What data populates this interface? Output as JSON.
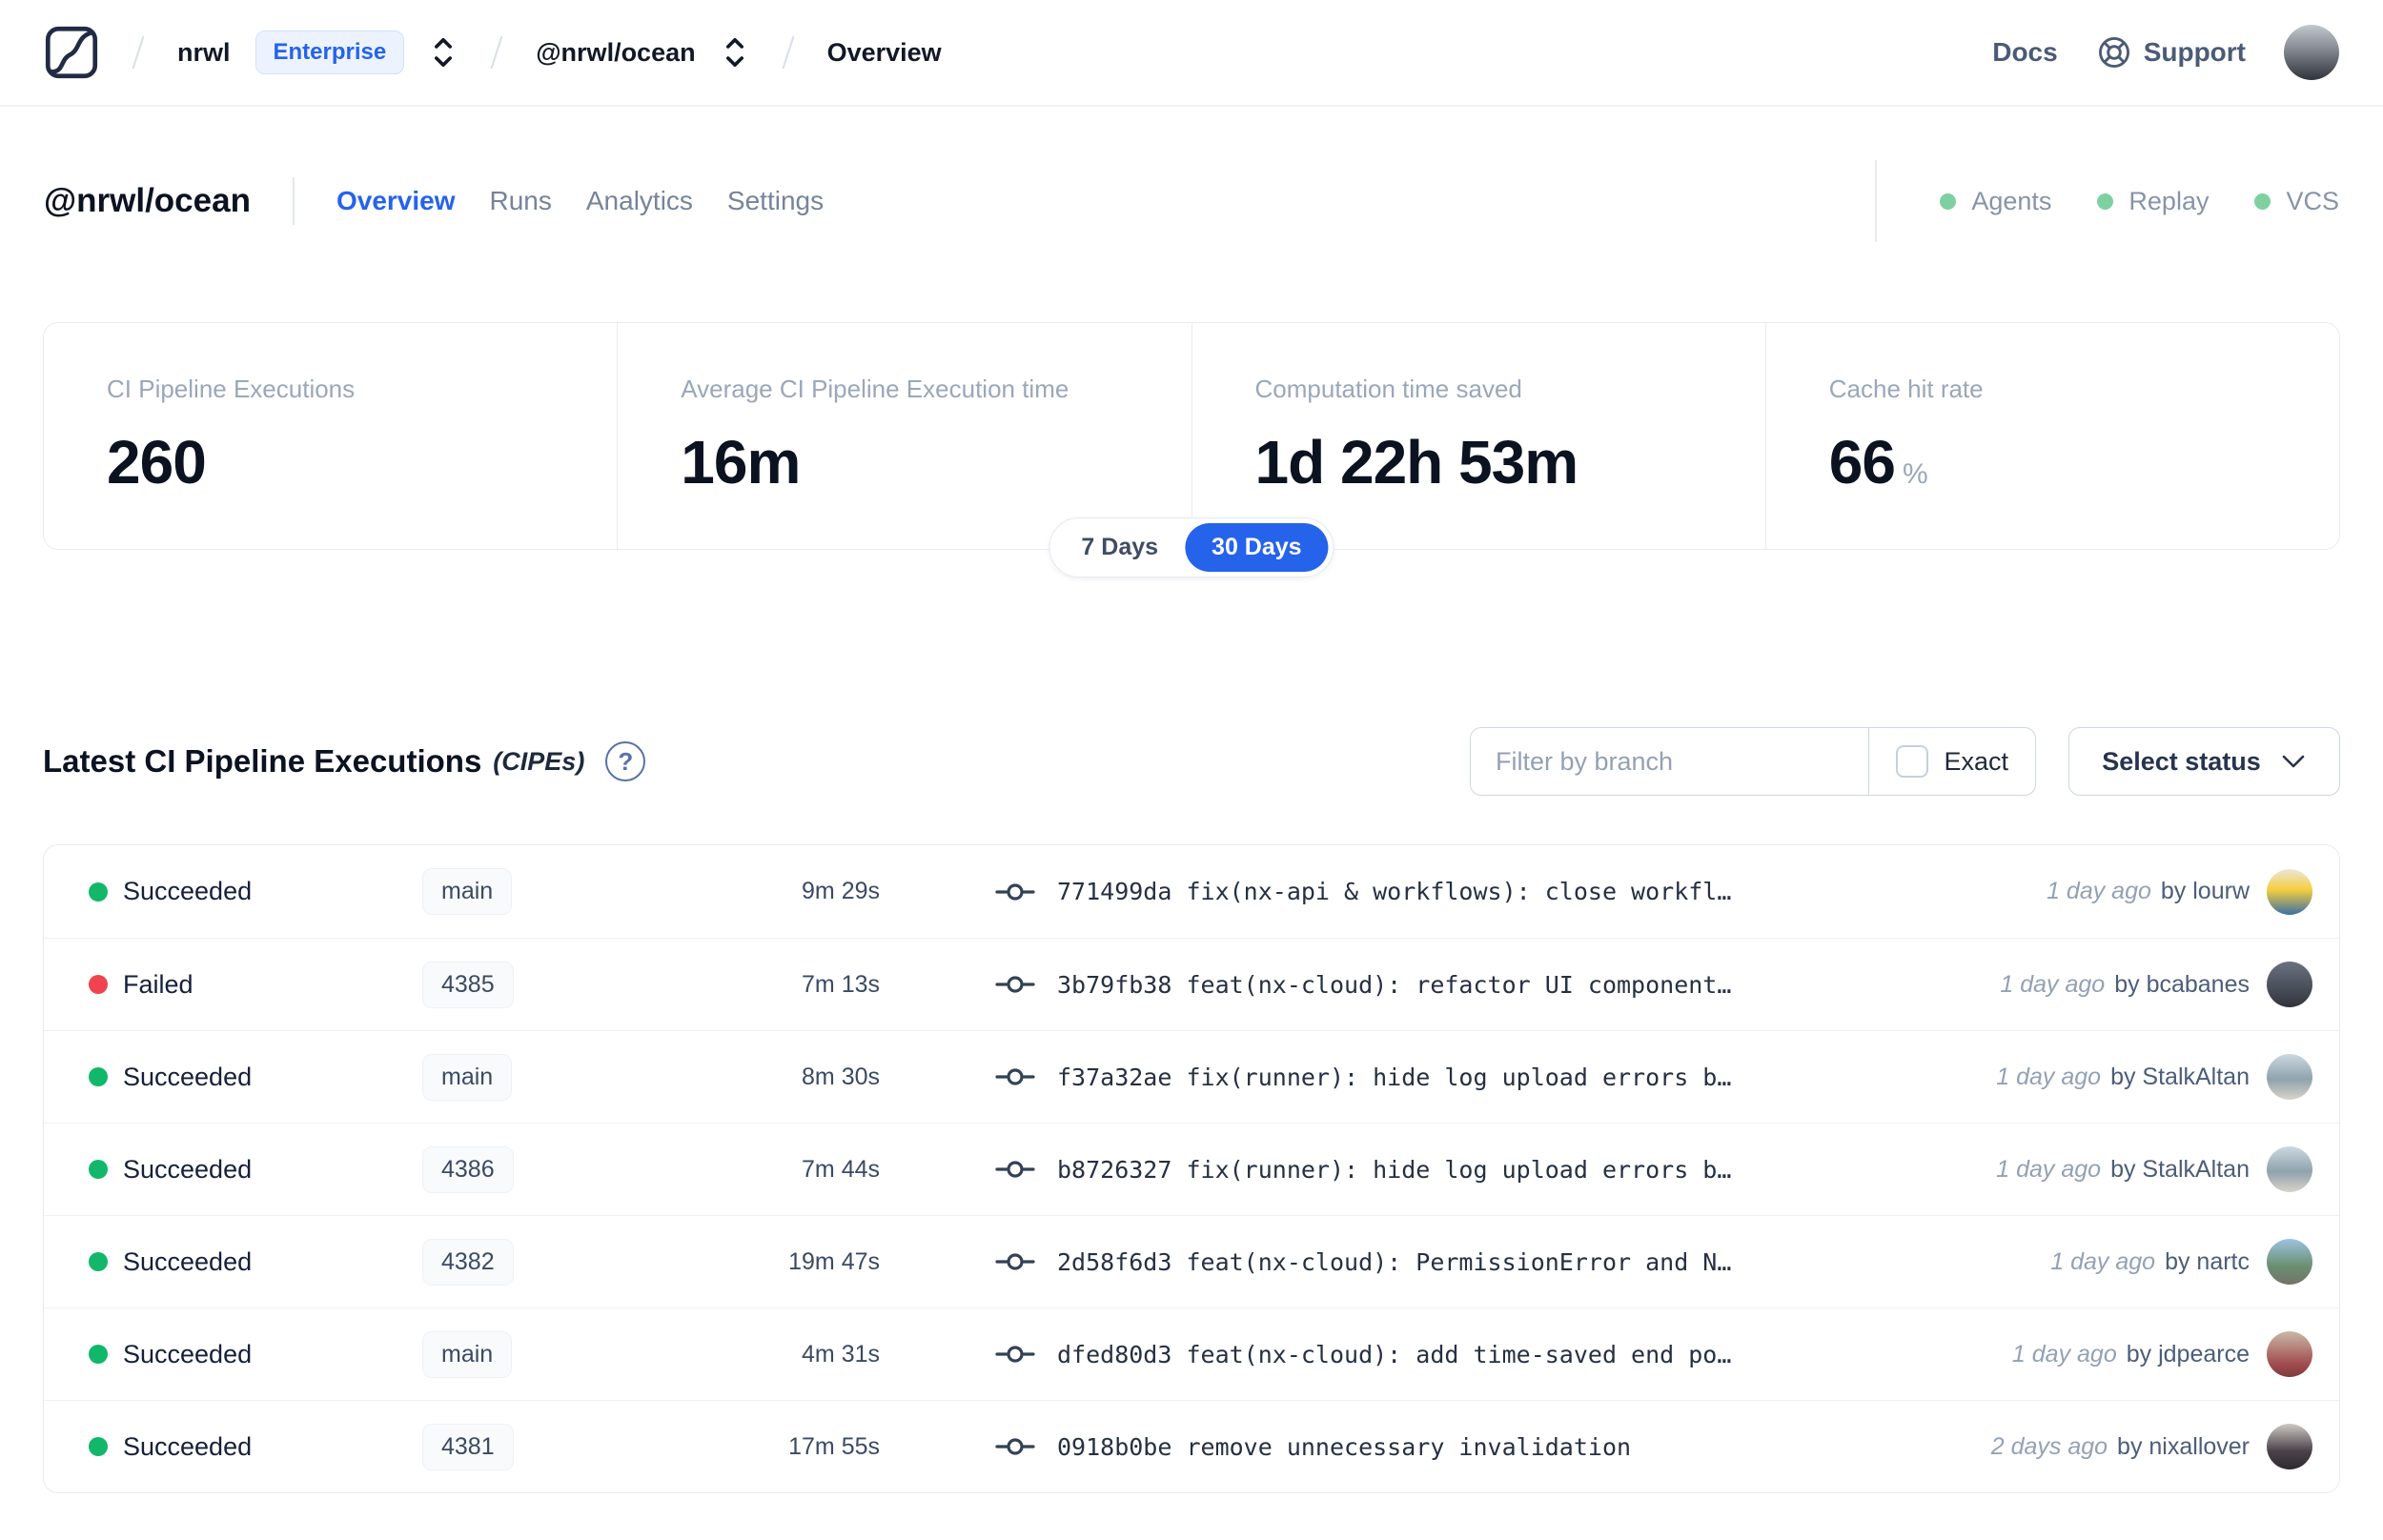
{
  "header": {
    "breadcrumb": {
      "org": "nrwl",
      "plan_badge": "Enterprise",
      "workspace": "@nrwl/ocean",
      "page": "Overview"
    },
    "docs_label": "Docs",
    "support_label": "Support",
    "avatar_bg": "linear-gradient(180deg,#c3c8cf 0%,#8a8f98 40%,#2f333b 100%)"
  },
  "workspace": {
    "title": "@nrwl/ocean",
    "tabs": [
      {
        "label": "Overview",
        "active": true
      },
      {
        "label": "Runs",
        "active": false
      },
      {
        "label": "Analytics",
        "active": false
      },
      {
        "label": "Settings",
        "active": false
      }
    ],
    "features": [
      {
        "label": "Agents"
      },
      {
        "label": "Replay"
      },
      {
        "label": "VCS"
      }
    ]
  },
  "stats": {
    "cards": [
      {
        "label": "CI Pipeline Executions",
        "value": "260",
        "suffix": ""
      },
      {
        "label": "Average CI Pipeline Execution time",
        "value": "16m",
        "suffix": ""
      },
      {
        "label": "Computation time saved",
        "value": "1d 22h 53m",
        "suffix": ""
      },
      {
        "label": "Cache hit rate",
        "value": "66",
        "suffix": "%"
      }
    ],
    "range_toggle": {
      "options": [
        "7 Days",
        "30 Days"
      ],
      "selected": "30 Days"
    }
  },
  "cipes": {
    "title": "Latest CI Pipeline Executions",
    "title_suffix": "(CIPEs)",
    "help_icon": "question-circle-icon",
    "filter_placeholder": "Filter by branch",
    "exact_label": "Exact",
    "status_select_label": "Select status",
    "rows": [
      {
        "status": "Succeeded",
        "branch": "main",
        "duration": "9m 29s",
        "commit": "771499da fix(nx-api & workflows): close workfl…",
        "time": "1 day ago",
        "author": "by lourw",
        "avatar_bg": "linear-gradient(180deg,#ece7da 0%,#f5ce3e 45%,#3a6ea8 100%)"
      },
      {
        "status": "Failed",
        "branch": "4385",
        "duration": "7m 13s",
        "commit": "3b79fb38 feat(nx-cloud): refactor UI component…",
        "time": "1 day ago",
        "author": "by bcabanes",
        "avatar_bg": "linear-gradient(180deg,#6b7280 0%,#30343c 100%)"
      },
      {
        "status": "Succeeded",
        "branch": "main",
        "duration": "8m 30s",
        "commit": "f37a32ae fix(runner): hide log upload errors b…",
        "time": "1 day ago",
        "author": "by StalkAltan",
        "avatar_bg": "linear-gradient(180deg,#cbd8e0 0%,#8fa3ad 55%,#d8d3c8 100%)"
      },
      {
        "status": "Succeeded",
        "branch": "4386",
        "duration": "7m 44s",
        "commit": "b8726327 fix(runner): hide log upload errors b…",
        "time": "1 day ago",
        "author": "by StalkAltan",
        "avatar_bg": "linear-gradient(180deg,#cbd8e0 0%,#8fa3ad 55%,#d8d3c8 100%)"
      },
      {
        "status": "Succeeded",
        "branch": "4382",
        "duration": "19m 47s",
        "commit": "2d58f6d3 feat(nx-cloud): PermissionError and N…",
        "time": "1 day ago",
        "author": "by nartc",
        "avatar_bg": "linear-gradient(180deg,#9ec3e0 0%,#6a8f6f 60%,#74736a 100%)"
      },
      {
        "status": "Succeeded",
        "branch": "main",
        "duration": "4m 31s",
        "commit": "dfed80d3 feat(nx-cloud): add time-saved end po…",
        "time": "1 day ago",
        "author": "by jdpearce",
        "avatar_bg": "linear-gradient(180deg,#c9b8a8 0%,#a24e50 70%,#7e3a3e 100%)"
      },
      {
        "status": "Succeeded",
        "branch": "4381",
        "duration": "17m 55s",
        "commit": "0918b0be remove unnecessary invalidation",
        "time": "2 days ago",
        "author": "by nixallover",
        "avatar_bg": "linear-gradient(180deg,#cfc9c4 0%,#4a4248 60%,#2e2a30 100%)"
      }
    ]
  },
  "colors": {
    "accent_blue": "#2563eb",
    "success_green": "#12b76a",
    "failed_red": "#ef4450",
    "feature_dot_green": "#7fd0a0"
  }
}
